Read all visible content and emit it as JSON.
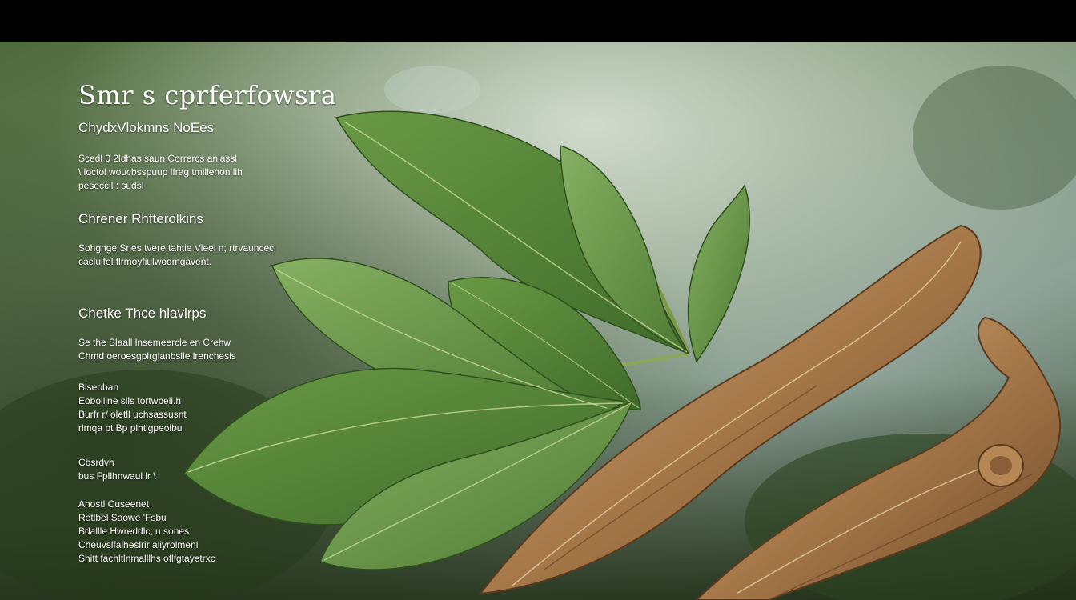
{
  "title": "Smr s cprferfowsra",
  "subtitle": "ChydxVlokmns NoEes",
  "sections": [
    {
      "lines": [
        "Scedl 0 2ldhas saun Corrercs anlassl",
        "\\ loctol woucbsspuup lfrag tmillenon lih",
        "peseccil : sudsl"
      ]
    },
    {
      "heading": "Chrener Rhfterolkins",
      "lines": [
        "Sohgnge Snes tvere tahtie Vleel n; rtrvauncecl",
        "caclulfel flrmoyfiulwodmgavent."
      ]
    },
    {
      "heading": "Chetke Thce hlavlrps",
      "lines": [
        "Se the Slaall lnsemeercle en Crehw",
        "Chmd oeroesgplrglanbslle lrenchesis"
      ]
    },
    {
      "lines": [
        "Biseoban",
        "Eobolline slls tortwbeli.h",
        "Burfr r/ oletll uchsassusnt",
        "rlmqa pt Bp plhtlgpeoibu"
      ]
    },
    {
      "lines": [
        "Cbsrdvh",
        "bus Fpllhnwaul lr \\"
      ]
    },
    {
      "lines": [
        "Anostl Cuseenet",
        "Retlbel Saowe 'Fsbu",
        "Bdallle Hwreddlc; u sones",
        "Cheuvslfalheslrir aliyrolmenl",
        "Shitt fachltlnmalllhs oflfgtayetrxc"
      ]
    }
  ]
}
